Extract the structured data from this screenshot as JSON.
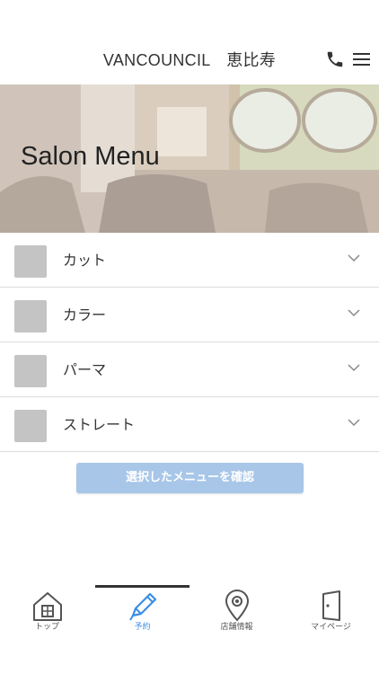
{
  "header": {
    "title": "VANCOUNCIL　恵比寿",
    "phone_icon": "phone-icon",
    "menu_icon": "hamburger-menu-icon"
  },
  "hero": {
    "title": "Salon Menu"
  },
  "menu": {
    "items": [
      {
        "label": "カット"
      },
      {
        "label": "カラー"
      },
      {
        "label": "パーマ"
      },
      {
        "label": "ストレート"
      }
    ]
  },
  "confirm_button": {
    "label": "選択したメニューを確認"
  },
  "tabbar": {
    "tabs": [
      {
        "label": "トップ",
        "icon": "home-icon"
      },
      {
        "label": "予約",
        "icon": "pencil-icon"
      },
      {
        "label": "店舗情報",
        "icon": "map-pin-icon"
      },
      {
        "label": "マイページ",
        "icon": "door-icon"
      }
    ],
    "active_index": 1
  },
  "colors": {
    "accent": "#3a8ee6",
    "button": "#a8c6e8",
    "thumb": "#c4c4c4"
  }
}
